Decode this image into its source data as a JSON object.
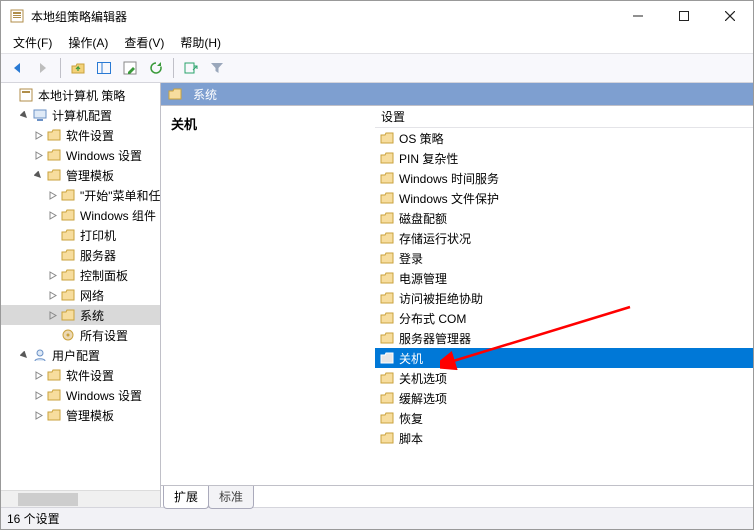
{
  "window": {
    "title": "本地组策略编辑器",
    "minimize": "—",
    "maximize": "☐",
    "close": "✕"
  },
  "menus": [
    "文件(F)",
    "操作(A)",
    "查看(V)",
    "帮助(H)"
  ],
  "tree": {
    "root": "本地计算机 策略",
    "computer_cfg": "计算机配置",
    "software_settings": "软件设置",
    "windows_settings": "Windows 设置",
    "admin_templates": "管理模板",
    "start_menu_taskbar": "\"开始\"菜单和任",
    "windows_components": "Windows 组件",
    "printers": "打印机",
    "server": "服务器",
    "control_panel": "控制面板",
    "network": "网络",
    "system": "系统",
    "all_settings": "所有设置",
    "user_cfg": "用户配置",
    "u_software_settings": "软件设置",
    "u_windows_settings": "Windows 设置",
    "u_admin_templates": "管理模板"
  },
  "path": "系统",
  "detail_heading": "关机",
  "column_header": "设置",
  "items": [
    "OS 策略",
    "PIN 复杂性",
    "Windows 时间服务",
    "Windows 文件保护",
    "磁盘配额",
    "存储运行状况",
    "登录",
    "电源管理",
    "访问被拒绝协助",
    "分布式 COM",
    "服务器管理器",
    "关机",
    "关机选项",
    "缓解选项",
    "恢复",
    "脚本"
  ],
  "selected_index": 11,
  "tabs": {
    "extended": "扩展",
    "standard": "标准"
  },
  "status": "16 个设置",
  "colors": {
    "selection": "#0078d7",
    "path_header": "#7e9fd0",
    "arrow": "#ff0000"
  }
}
